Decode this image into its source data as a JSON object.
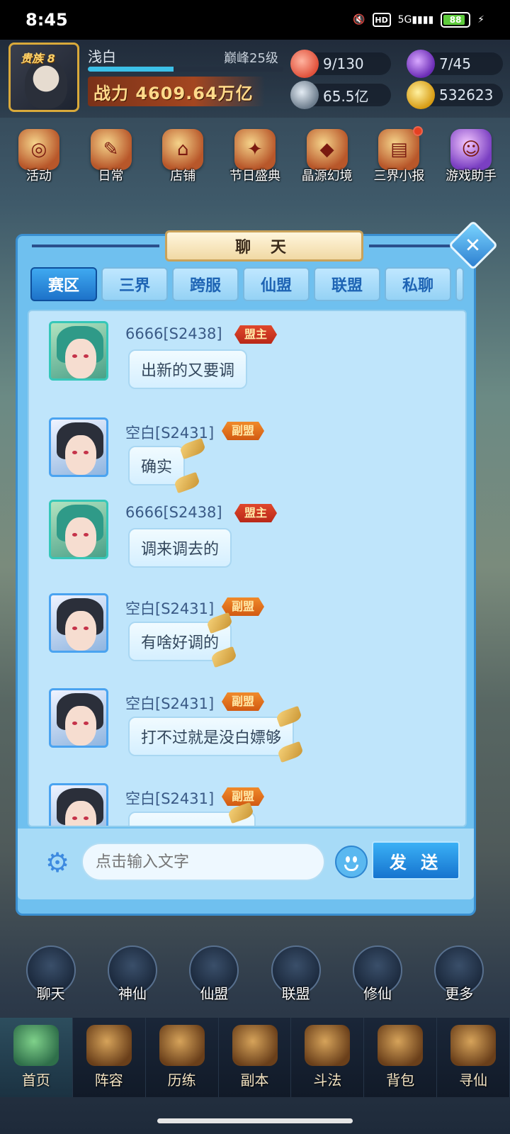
{
  "statusbar": {
    "time": "8:45",
    "hd": "HD",
    "network": "5G",
    "battery": "88"
  },
  "player": {
    "vip": "贵族 8",
    "name": "浅白",
    "level": "巅峰25级",
    "exp_fraction": 0.44,
    "power": "战力 4609.64万亿",
    "resources": {
      "stamina": "9/130",
      "energy": "7/45",
      "coins": "65.5亿",
      "gold": "532623"
    }
  },
  "shortcuts": [
    {
      "label": "活动",
      "icon": "event-icon"
    },
    {
      "label": "日常",
      "icon": "daily-icon"
    },
    {
      "label": "店铺",
      "icon": "shop-icon"
    },
    {
      "label": "节日盛典",
      "icon": "gift-icon"
    },
    {
      "label": "晶源幻境",
      "icon": "crystal-icon"
    },
    {
      "label": "三界小报",
      "icon": "newspaper-icon"
    },
    {
      "label": "游戏助手",
      "icon": "helper-icon"
    }
  ],
  "chat": {
    "title": "聊 天",
    "tabs": [
      "赛区",
      "三界",
      "跨服",
      "仙盟",
      "联盟",
      "私聊"
    ],
    "active_tab": "赛区",
    "messages": [
      {
        "name": "6666[S2438]",
        "role": "盟主",
        "text": "出新的又要调",
        "avatar": "green-hair"
      },
      {
        "name": "空白[S2431]",
        "role": "副盟",
        "text": "确实",
        "avatar": "white-hair"
      },
      {
        "name": "6666[S2438]",
        "role": "盟主",
        "text": "调来调去的",
        "avatar": "green-hair"
      },
      {
        "name": "空白[S2431]",
        "role": "副盟",
        "text": "有啥好调的",
        "avatar": "white-hair"
      },
      {
        "name": "空白[S2431]",
        "role": "副盟",
        "text": "打不过就是没白嫖够",
        "avatar": "white-hair"
      },
      {
        "name": "空白[S2431]",
        "role": "副盟",
        "text": "",
        "avatar": "white-hair"
      }
    ],
    "input_placeholder": "点击输入文字",
    "send_label": "发 送"
  },
  "features": [
    "聊天",
    "神仙",
    "仙盟",
    "联盟",
    "修仙",
    "更多"
  ],
  "nav": [
    "首页",
    "阵容",
    "历练",
    "副本",
    "斗法",
    "背包",
    "寻仙"
  ],
  "nav_active": "首页"
}
